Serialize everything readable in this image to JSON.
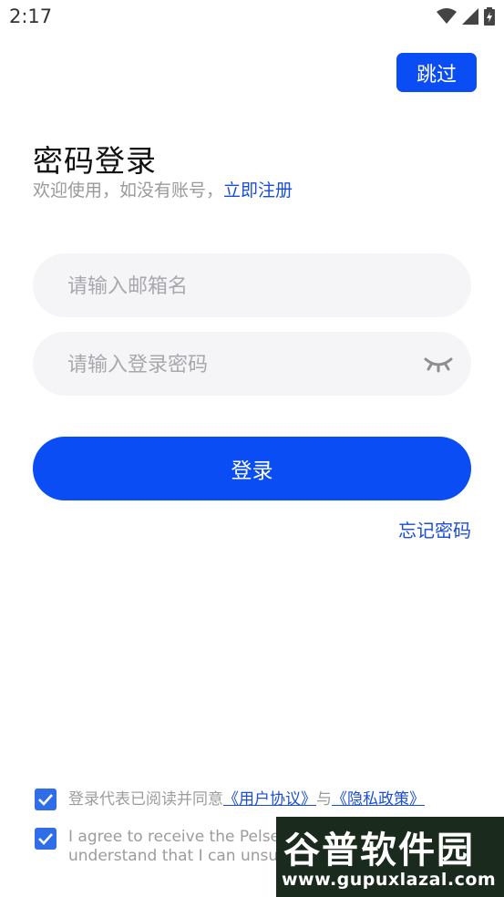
{
  "status_bar": {
    "time": "2:17",
    "icons": [
      "wifi-icon",
      "signal-icon",
      "battery-icon"
    ]
  },
  "header": {
    "skip_label": "跳过"
  },
  "login": {
    "title": "密码登录",
    "subtitle": "欢迎使用，如没有账号，",
    "register_link": "立即注册",
    "email_placeholder": "请输入邮箱名",
    "password_placeholder": "请输入登录密码",
    "login_button": "登录",
    "forgot_password": "忘记密码"
  },
  "agreement": {
    "line1_prefix": "登录代表已阅读并同意",
    "user_agreement": "《用户协议》",
    "and": "与",
    "privacy_policy": "《隐私政策》",
    "line2": "I agree to receive the Pelsee",
    "line3": "understand that I can unsubs"
  },
  "watermark": {
    "cn": "谷普软件园",
    "url": "www.gupuxlazal.com"
  },
  "colors": {
    "primary": "#0a4df5",
    "link": "#1a4ed8",
    "checkbox": "#2f6de9",
    "field_bg": "#f5f5f7"
  }
}
